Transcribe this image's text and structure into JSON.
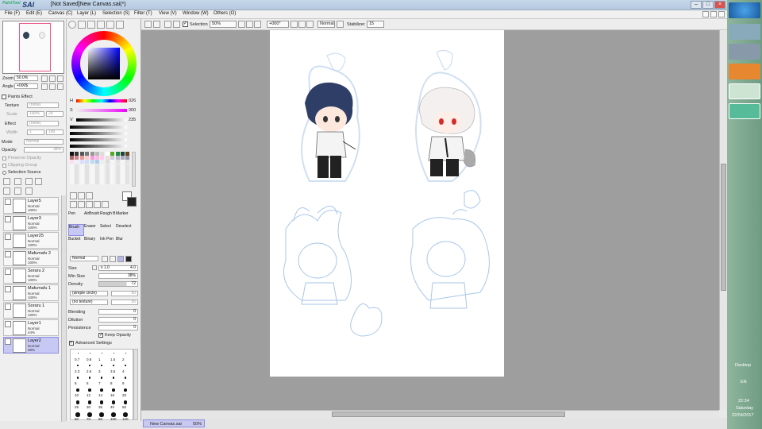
{
  "app": {
    "logo": "SAI",
    "logo_small": "PaintTool",
    "title": "[Not Saved]New Canvas.sai(*)"
  },
  "menu": [
    "File (F)",
    "Edit (E)",
    "Canvas (C)",
    "Layer (L)",
    "Selection (S)",
    "Filter (T)",
    "View (V)",
    "Window (W)",
    "Others (O)"
  ],
  "toolbar": {
    "selection_label": "Selection",
    "zoom_value": "50%",
    "angle_value": "+000°",
    "blend_value": "Normal",
    "stabilizer_label": "Stabilizer",
    "stabilizer_value": "15"
  },
  "navigator": {
    "zoom_label": "Zoom",
    "zoom_value": "50.0%",
    "angle_label": "Angle",
    "angle_value": "+000$"
  },
  "paints_effect": {
    "header": "Paints Effect",
    "texture_label": "Texture",
    "texture_value": "(none)",
    "scale_label": "Scale",
    "scale_value": "100%",
    "scale_num": "20",
    "effect_label": "Effect",
    "effect_value": "(none)",
    "width_label": "Width",
    "width_value": "1",
    "width_num": "100"
  },
  "layer_props": {
    "mode_label": "Mode",
    "mode_value": "Normal",
    "opacity_label": "Opacity",
    "opacity_value": "38%",
    "preserve_opacity": "Preserve Opacity",
    "clipping_group": "Clipping Group",
    "selection_source": "Selection Source"
  },
  "layers": [
    {
      "name": "Layer5",
      "mode": "Normal",
      "opacity": "100%",
      "type": "layer"
    },
    {
      "name": "Layer3",
      "mode": "Normal",
      "opacity": "100%",
      "type": "layer"
    },
    {
      "name": "Layer25",
      "mode": "Normal",
      "opacity": "100%",
      "type": "layer"
    },
    {
      "name": "Mafumafu 2",
      "mode": "Normal",
      "opacity": "100%",
      "type": "folder"
    },
    {
      "name": "Soraru 2",
      "mode": "Normal",
      "opacity": "100%",
      "type": "folder"
    },
    {
      "name": "Mafumafu 1",
      "mode": "Normal",
      "opacity": "100%",
      "type": "folder"
    },
    {
      "name": "Soraru 1",
      "mode": "Normal",
      "opacity": "100%",
      "type": "folder"
    },
    {
      "name": "Layer1",
      "mode": "Normal",
      "opacity": "44%",
      "type": "layer"
    },
    {
      "name": "Layer2",
      "mode": "Normal",
      "opacity": "38%",
      "type": "layer",
      "selected": true
    }
  ],
  "color": {
    "h_label": "H",
    "h_value": "026",
    "s_label": "S",
    "s_value": "000",
    "v_label": "V",
    "v_value": "235"
  },
  "tools": {
    "row1": [
      "Pen",
      "AirBrush",
      "Rough B",
      "Marker"
    ],
    "row2": [
      "Brush",
      "Eraser",
      "Select",
      "Deselect"
    ],
    "row3": [
      "Bucket",
      "Binary",
      "Ink Pen",
      "Blur"
    ],
    "selected": "Brush"
  },
  "brush": {
    "mode_value": "Normal",
    "size_label": "Size",
    "size_mult": "x 1.0",
    "size_value": "4.0",
    "min_size_label": "Min Size",
    "min_size_value": "38%",
    "density_label": "Density",
    "density_value": "72",
    "shape_value": "(simple circle)",
    "shape_num": "50",
    "texture_value": "(no texture)",
    "texture_num": "95",
    "blending_label": "Blending",
    "blending_value": "0",
    "dilution_label": "Dilution",
    "dilution_value": "0",
    "persistence_label": "Persistence",
    "persistence_value": "0",
    "keep_opacity": "Keep Opacity",
    "advanced": "Advanced Settings",
    "sizes": [
      "0.7",
      "0.8",
      "1",
      "1.5",
      "2",
      "2.3",
      "2.6",
      "3",
      "3.5",
      "4",
      "5",
      "6",
      "7",
      "8",
      "9",
      "10",
      "12",
      "14",
      "16",
      "20",
      "25",
      "30",
      "35",
      "40",
      "50",
      "60",
      "70",
      "80",
      "100",
      "120"
    ]
  },
  "status": {
    "tab_label": "New Canvas.sai",
    "tab_zoom": "50%"
  },
  "taskbar": {
    "desktop_label": "Desktop",
    "lang": "EN",
    "time": "22:34",
    "day": "Saturday",
    "date": "22/04/2017"
  },
  "colors": {
    "accent": "#b8b8f0",
    "canvas_bg": "#9e9e9e",
    "sketch": "#a9c7ea"
  }
}
